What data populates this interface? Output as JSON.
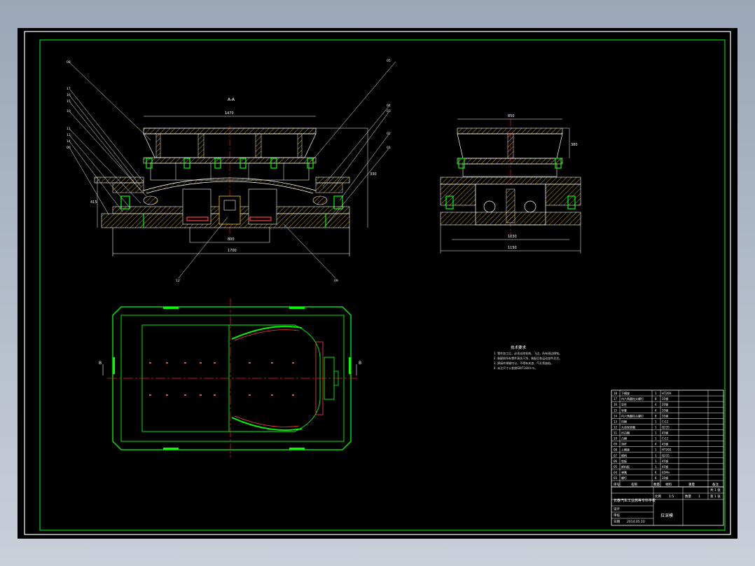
{
  "colors": {
    "background": "#000000",
    "frame_white": "#ffffff",
    "frame_green": "#00ff00",
    "section_yellow": "#ffcc00",
    "centerline_red": "#ff2020",
    "hidden_line_red": "#ff4040",
    "accent_orange": "#ff8800"
  },
  "section_view": {
    "title": "A-A",
    "dimensions": {
      "top_width": "1470",
      "middle_width": "800",
      "bottom_width": "1700",
      "height_left": "415",
      "height_right": "330"
    },
    "balloons_left": [
      "08",
      "17",
      "16",
      "15",
      "10",
      "11",
      "13",
      "14",
      "06"
    ],
    "balloons_right": [
      "05",
      "04",
      "03",
      "02",
      "01"
    ],
    "balloons_bottom": [
      "12",
      "09"
    ]
  },
  "side_view": {
    "dimensions": {
      "top_width": "850",
      "bottom_width": "1150",
      "inner_width": "1030",
      "height": "380"
    }
  },
  "plan_view": {
    "markers": [
      "B",
      "B"
    ]
  },
  "technical_requirements": {
    "title": "技术要求",
    "lines": [
      "1. 零件加工后，必须去除毛刺、飞边，所有锐边倒钝。",
      "2. 装配前所有零件清洗干净，装配后各运动部件灵活。",
      "3. 焊接件焊缝均匀，不得有夹渣、气孔等缺陷。",
      "4. 未注尺寸公差按GB/T1804-m。"
    ]
  },
  "bom": {
    "rows": [
      {
        "no": "18",
        "name": "下模座",
        "qty": "1",
        "material": "HT200",
        "note": ""
      },
      {
        "no": "17",
        "name": "内六角圆柱头螺钉",
        "qty": "8",
        "material": "35钢",
        "note": ""
      },
      {
        "no": "16",
        "name": "导柱",
        "qty": "4",
        "material": "20钢",
        "note": ""
      },
      {
        "no": "15",
        "name": "导套",
        "qty": "4",
        "material": "20钢",
        "note": ""
      },
      {
        "no": "14",
        "name": "内六角圆柱头螺钉",
        "qty": "8",
        "material": "35钢",
        "note": ""
      },
      {
        "no": "13",
        "name": "凹模",
        "qty": "1",
        "material": "Cr12",
        "note": ""
      },
      {
        "no": "12",
        "name": "大齿轮垫圈",
        "qty": "1",
        "material": "Q235",
        "note": ""
      },
      {
        "no": "11",
        "name": "压边圈",
        "qty": "1",
        "material": "45钢",
        "note": ""
      },
      {
        "no": "10",
        "name": "凸模",
        "qty": "1",
        "material": "Cr12",
        "note": ""
      },
      {
        "no": "09",
        "name": "顶杆",
        "qty": "4",
        "material": "45钢",
        "note": ""
      },
      {
        "no": "08",
        "name": "上模座",
        "qty": "1",
        "material": "HT200",
        "note": ""
      },
      {
        "no": "07",
        "name": "模柄",
        "qty": "1",
        "material": "Q235",
        "note": ""
      },
      {
        "no": "06",
        "name": "垫板",
        "qty": "1",
        "material": "45钢",
        "note": ""
      },
      {
        "no": "05",
        "name": "卸料板",
        "qty": "1",
        "material": "45钢",
        "note": ""
      },
      {
        "no": "04",
        "name": "弹簧",
        "qty": "6",
        "material": "65Mn",
        "note": ""
      },
      {
        "no": "03",
        "name": "螺钉",
        "qty": "6",
        "material": "35钢",
        "note": ""
      }
    ],
    "header": {
      "no": "序号",
      "name": "名称",
      "qty": "数量",
      "material": "材料",
      "weight": "重量",
      "note": "备注"
    }
  },
  "title_block": {
    "school": "长春汽车工业高等专科学校",
    "scale_label": "比例",
    "scale_value": "1:5",
    "sheet_label": "共 1 张",
    "sheet_no": "第 1 张",
    "quantity_label": "数量",
    "quantity_value": "1",
    "drawing_title": "拉深模",
    "rows": [
      "设计",
      "审核",
      "日期"
    ],
    "date_value": "2014.05.10"
  }
}
